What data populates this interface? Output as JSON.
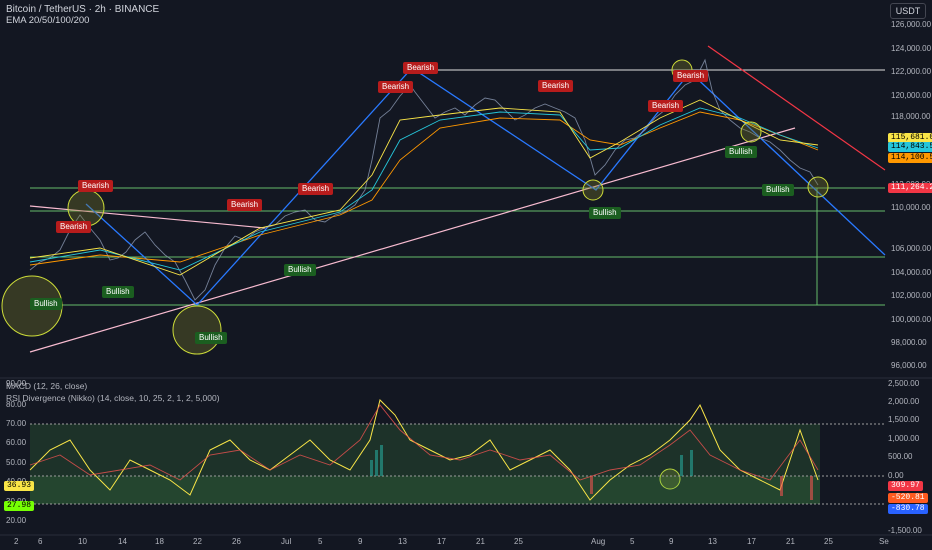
{
  "header": {
    "title": "Bitcoin / TetherUS · 2h · BINANCE",
    "indicator_ema": "EMA 20/50/100/200",
    "quote_currency": "USDT"
  },
  "indicators": {
    "macd_title": "MACD (12, 26, close)",
    "rsi_title": "RSI Divergence (Nikko) (14, close, 10, 25, 2, 1, 2, 5,000)"
  },
  "price_axis": [
    "126,000.00",
    "124,000.00",
    "122,000.00",
    "120,000.00",
    "118,000.00",
    "112,000.00",
    "110,000.00",
    "106,000.00",
    "104,000.00",
    "102,000.00",
    "100,000.00",
    "98,000.00",
    "96,000.00"
  ],
  "price_tags": [
    {
      "label": "115,681.07",
      "color": "#f9e547",
      "text": "#000"
    },
    {
      "label": "114,843.52",
      "color": "#26c6da",
      "text": "#000"
    },
    {
      "label": "114,100.57",
      "color": "#ff9800",
      "text": "#000"
    },
    {
      "label": "111,264.25",
      "color": "#f23645",
      "text": "#fff"
    }
  ],
  "macd_axis": [
    "2,500.00",
    "2,000.00",
    "1,500.00",
    "1,000.00",
    "500.00",
    "0.00",
    "-1,500.00"
  ],
  "macd_tags": [
    {
      "label": "309.97",
      "color": "#f23645",
      "text": "#fff"
    },
    {
      "label": "-520.81",
      "color": "#ff5a1f",
      "text": "#fff"
    },
    {
      "label": "-830.78",
      "color": "#2962ff",
      "text": "#fff"
    }
  ],
  "rsi_axis": [
    "90.00",
    "80.00",
    "70.00",
    "60.00",
    "50.00",
    "40.00",
    "30.00",
    "20.00"
  ],
  "rsi_tags": [
    {
      "label": "36.93",
      "color": "#f9e547",
      "text": "#000"
    },
    {
      "label": "27.98",
      "color": "#76ff03",
      "text": "#000"
    }
  ],
  "time_axis": [
    "2",
    "6",
    "10",
    "14",
    "18",
    "22",
    "26",
    "Jul",
    "5",
    "9",
    "13",
    "17",
    "21",
    "25",
    "Aug",
    "5",
    "9",
    "13",
    "17",
    "21",
    "25",
    "Se"
  ],
  "signals": {
    "bearish": "Bearish",
    "bullish": "Bullish"
  },
  "colors": {
    "background": "#131722",
    "bearish": "#b71c1c",
    "bullish": "#1b5e20",
    "trend_blue": "#2979ff",
    "trend_red": "#f23645",
    "level_green": "#66bb6a"
  }
}
